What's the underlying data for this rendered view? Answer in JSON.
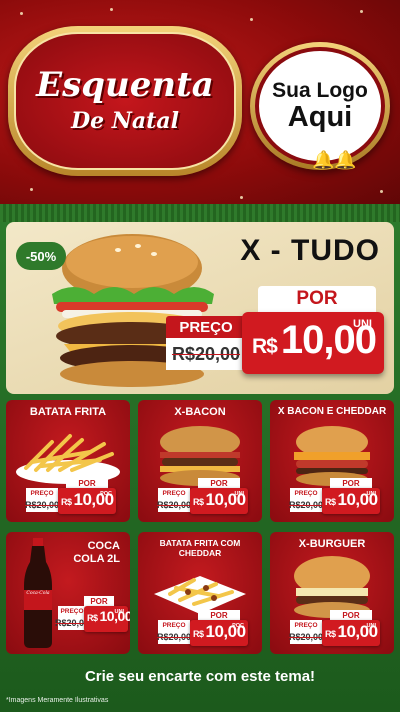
{
  "header": {
    "title_main": "Esquenta",
    "title_sub": "De Natal",
    "logo_line1": "Sua Logo",
    "logo_line2": "Aqui"
  },
  "featured": {
    "name": "X - TUDO",
    "discount": "-50%",
    "por_label": "POR",
    "preco_label": "PREÇO",
    "old_price": "R$20,00",
    "currency": "R$",
    "price": "10,00",
    "unit": "UNI"
  },
  "products": [
    {
      "name": "BATATA FRITA",
      "preco_label": "PREÇO",
      "old_price": "R$20,00",
      "por_label": "POR",
      "currency": "R$",
      "price": "10,00",
      "unit": "POÇ"
    },
    {
      "name": "X-BACON",
      "preco_label": "PREÇO",
      "old_price": "R$20,00",
      "por_label": "POR",
      "currency": "R$",
      "price": "10,00",
      "unit": "UNI"
    },
    {
      "name": "X BACON E CHEDDAR",
      "preco_label": "PREÇO",
      "old_price": "R$20,00",
      "por_label": "POR",
      "currency": "R$",
      "price": "10,00",
      "unit": "UNI"
    },
    {
      "name_line1": "COCA",
      "name_line2": "COLA 2L",
      "brand_label": "Coca-Cola",
      "preco_label": "PREÇO",
      "old_price": "R$20,00",
      "por_label": "POR",
      "currency": "R$",
      "price": "10,00",
      "unit": "UNI"
    },
    {
      "name": "BATATA FRITA COM CHEDDAR",
      "preco_label": "PREÇO",
      "old_price": "R$20,00",
      "por_label": "POR",
      "currency": "R$",
      "price": "10,00",
      "unit": "POÇ"
    },
    {
      "name": "X-BURGUER",
      "preco_label": "PREÇO",
      "old_price": "R$20,00",
      "por_label": "POR",
      "currency": "R$",
      "price": "10,00",
      "unit": "UNI"
    }
  ],
  "footer": {
    "cta": "Crie seu encarte com este tema!",
    "note": "*Imagens Meramente Ilustrativas"
  },
  "colors": {
    "red": "#c4161c",
    "dark_red": "#8a0b0f",
    "green": "#2f7a2b",
    "gold": "#e2b64a"
  }
}
